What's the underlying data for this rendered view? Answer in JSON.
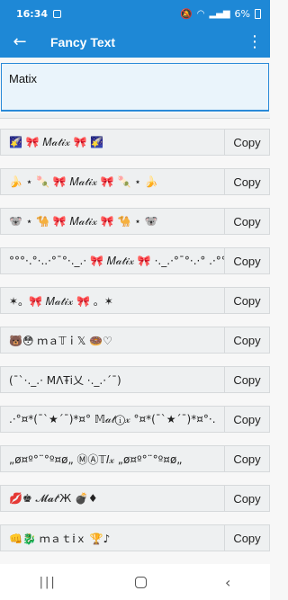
{
  "status_bar": {
    "time": "16:34",
    "battery_text": "6%"
  },
  "app_bar": {
    "title": "Fancy Text",
    "back_icon": "arrow-left-icon",
    "menu_icon": "more-vert-icon"
  },
  "input": {
    "value": "Matix"
  },
  "copy_label": "Copy",
  "items": [
    {
      "text": "🌠 🎀 𝑀𝒶𝓉𝒾𝓍 🎀 🌠"
    },
    {
      "text": "🍌 ⋆ 🍡 🎀 𝑀𝒶𝓉𝒾𝓍 🎀 🍡 ⋆ 🍌"
    },
    {
      "text": "🐨 ⋆ 🐪 🎀 𝑀𝒶𝓉𝒾𝓍 🎀 🐪 ⋆ 🐨"
    },
    {
      "text": "°°°·.°·..·°¯°·._.·  🎀  𝑀𝒶𝓉𝒾𝓍  🎀  ·._.·°¯°·.·° .·°°°"
    },
    {
      "text": "✶。🎀 𝑀𝒶𝓉𝒾𝓍 🎀 。✶"
    },
    {
      "text": "🐻😳  ｍａ𝕋ｉ𝕏  🍩♡"
    },
    {
      "text": "(¯`·._.· MΛŦi乂 ·._.·´¯)"
    },
    {
      "text": ".·°¤*(¯`★´¯)*¤° 𝕄𝒶𝓉ⓘ𝓍 °¤*(¯`★´¯)*¤°·."
    },
    {
      "text": "„ø¤º°¨°º¤ø„ ⓂⒶ𝕋𝐼𝓍 „ø¤º°¨°º¤ø„"
    },
    {
      "text": "💋♚  𝓜𝓪𝓉ⁱЖ  💣♦"
    },
    {
      "text": "👊🐉  ｍａｔ𝕚ｘ  🏆♪"
    }
  ],
  "nav": {
    "recents_icon": "recents-icon",
    "home_icon": "home-icon",
    "back_icon": "nav-back-icon"
  }
}
